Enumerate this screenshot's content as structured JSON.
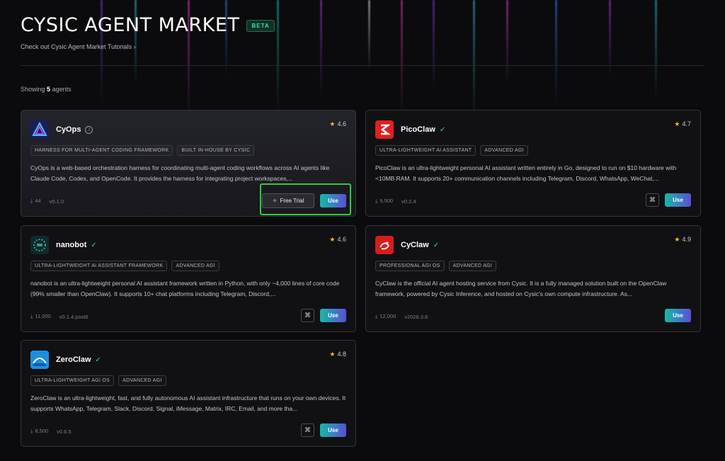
{
  "header": {
    "title": "CYSIC AGENT MARKET",
    "beta": "BETA",
    "tutorial_link": "Check out Cysic Agent Market Tutorials ›"
  },
  "summary": {
    "prefix": "Showing",
    "count": "5",
    "suffix": "agents"
  },
  "colors": {
    "accent_start": "#16b8a8",
    "accent_end": "#5a4fd6",
    "verified": "#39d98a",
    "star": "#f5b82e",
    "highlight": "#2ecc40"
  },
  "agents": [
    {
      "name": "CyOps",
      "badge_icon": "info-icon",
      "rating": "4.6",
      "tags": [
        "HARNESS FOR MULTI-AGENT CODING FRAMEWORK",
        "BUILT IN-HOUSE BY CYSIC"
      ],
      "description": "CyOps is a web-based orchestration harness for coordinating multi-agent coding workflows across AI agents like Claude Code, Codex, and OpenCode. It provides the harness for integrating project workspaces,...",
      "downloads": "44",
      "version": "v0.1.0",
      "free_trial_label": "Free Trial",
      "use_label": "Use"
    },
    {
      "name": "PicoClaw",
      "badge_icon": "verified-check-icon",
      "rating": "4.7",
      "tags": [
        "ULTRA-LIGHTWEIGHT AI ASSISTANT",
        "ADVANCED AGI"
      ],
      "description": "PicoClaw is an ultra-lightweight personal AI assistant written entirely in Go, designed to run on $10 hardware with <10MB RAM. It supports 20+ communication channels including Telegram, Discord, WhatsApp, WeChat,...",
      "downloads": "9,500",
      "version": "v0.2.4",
      "use_label": "Use"
    },
    {
      "name": "nanobot",
      "badge_icon": "verified-check-icon",
      "rating": "4.6",
      "tags": [
        "ULTRA-LIGHTWEIGHT AI ASSISTANT FRAMEWORK",
        "ADVANCED AGI"
      ],
      "description": "nanobot is an ultra-lightweight personal AI assistant framework written in Python, with only ~4,000 lines of core code (99% smaller than OpenClaw). It supports 10+ chat platforms including Telegram, Discord,...",
      "downloads": "11,000",
      "version": "v0.1.4.post6",
      "use_label": "Use"
    },
    {
      "name": "CyClaw",
      "badge_icon": "verified-check-icon",
      "rating": "4.9",
      "tags": [
        "PROFESSIONAL AGI OS",
        "ADVANCED AGI"
      ],
      "description": "CyClaw is the official AI agent hosting service from Cysic. It is a fully managed solution built on the OpenClaw framework, powered by Cysic Inference, and hosted on Cysic's own compute infrastructure. As...",
      "downloads": "12,000",
      "version": "v2026.3.8",
      "use_label": "Use"
    },
    {
      "name": "ZeroClaw",
      "badge_icon": "verified-check-icon",
      "rating": "4.8",
      "tags": [
        "ULTRA-LIGHTWEIGHT AGI OS",
        "ADVANCED AGI"
      ],
      "description": "ZeroClaw is an ultra-lightweight, fast, and fully autonomous AI assistant infrastructure that runs on your own devices. It supports WhatsApp, Telegram, Slack, Discord, Signal, iMessage, Matrix, IRC, Email, and more tha...",
      "downloads": "8,500",
      "version": "v0.6.5",
      "use_label": "Use"
    }
  ]
}
